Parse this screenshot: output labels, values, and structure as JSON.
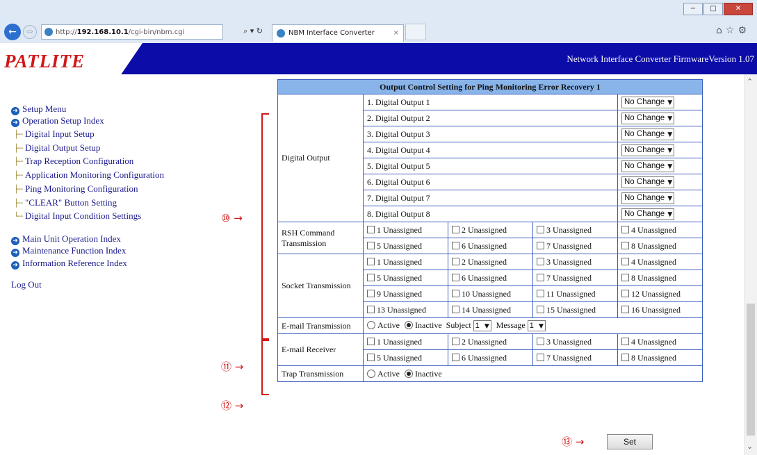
{
  "browser": {
    "url_prefix": "http://",
    "url_host": "192.168.10.1",
    "url_path": "/cgi-bin/nbm.cgi",
    "addr_controls": "⌕ ▾ ↻",
    "tab_title": "NBM Interface Converter",
    "tab_close": "×",
    "window_buttons": [
      "−",
      "□",
      "✕"
    ],
    "toolbar_icons": "⌂☆⚙"
  },
  "banner": {
    "logo": "PATLITE",
    "firmware": "Network Interface Converter  FirmwareVersion 1.07"
  },
  "sidebar": {
    "setup_menu": "Setup Menu",
    "operation_setup_index": "Operation Setup Index",
    "sub_items": [
      "Digital Input Setup",
      "Digital Output Setup",
      "Trap Reception Configuration",
      "Application Monitoring Configuration",
      "Ping Monitoring Configuration",
      "\"CLEAR\" Button Setting",
      "Digital Input Condition Settings"
    ],
    "main_unit_index": "Main Unit Operation Index",
    "maintenance_index": "Maintenance Function Index",
    "information_index": "Information Reference Index",
    "logout": "Log Out"
  },
  "table": {
    "title": "Output Control Setting for Ping Monitoring Error Recovery 1",
    "digital_output_label": "Digital Output",
    "digital_outputs": [
      "1. Digital Output 1",
      "2. Digital Output 2",
      "3. Digital Output 3",
      "4. Digital Output 4",
      "5. Digital Output 5",
      "6. Digital Output 6",
      "7. Digital Output 7",
      "8. Digital Output 8"
    ],
    "select_value": "No Change",
    "rsh_label": "RSH Command Transmission",
    "rsh_items": [
      "1 Unassigned",
      "2 Unassigned",
      "3 Unassigned",
      "4 Unassigned",
      "5 Unassigned",
      "6 Unassigned",
      "7 Unassigned",
      "8 Unassigned"
    ],
    "socket_label": "Socket Transmission",
    "socket_items": [
      "1 Unassigned",
      "2 Unassigned",
      "3 Unassigned",
      "4 Unassigned",
      "5 Unassigned",
      "6 Unassigned",
      "7 Unassigned",
      "8 Unassigned",
      "9 Unassigned",
      "10 Unassigned",
      "11 Unassigned",
      "12 Unassigned",
      "13 Unassigned",
      "14 Unassigned",
      "15 Unassigned",
      "16 Unassigned"
    ],
    "email_label": "E-mail Transmission",
    "active": "Active",
    "inactive": "Inactive",
    "subject_label": "Subject",
    "subject_value": "1",
    "message_label": "Message",
    "message_value": "1",
    "receiver_label": "E-mail Receiver",
    "receiver_items": [
      "1 Unassigned",
      "2 Unassigned",
      "3 Unassigned",
      "4 Unassigned",
      "5 Unassigned",
      "6 Unassigned",
      "7 Unassigned",
      "8 Unassigned"
    ],
    "trap_label": "Trap Transmission"
  },
  "annotations": {
    "a10": "⑩ →",
    "a11": "⑪ →",
    "a12": "⑫ →",
    "a13": "⑬ →"
  },
  "set_button": "Set",
  "colors": {
    "banner": "#0c0ca8",
    "logo": "#d01818",
    "table_header": "#88b4ea",
    "table_border": "#3a5fbd",
    "annotation": "#d01818"
  }
}
